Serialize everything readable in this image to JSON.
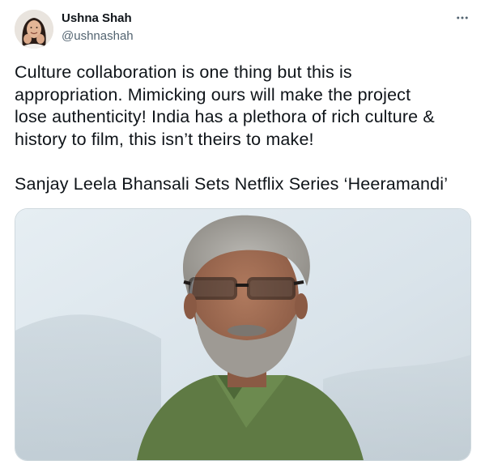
{
  "author": {
    "name": "Ushna Shah",
    "handle": "@ushnashah",
    "avatar_icon": "profile-photo"
  },
  "menu": {
    "icon": "more-horizontal-icon"
  },
  "tweet": {
    "lines_para1": [
      "Culture collaboration is one thing but this is",
      "appropriation. Mimicking ours will make the project",
      "lose authenticity! India has a plethora of rich culture &",
      "history to film, this isn’t theirs to make!"
    ],
    "headline": "Sanjay Leela Bhansali Sets Netflix Series ‘Heeramandi’"
  },
  "link_card": {
    "image_icon": "article-photo"
  },
  "colors": {
    "text": "#0f1419",
    "secondary": "#536471",
    "border": "#cfd9de"
  }
}
